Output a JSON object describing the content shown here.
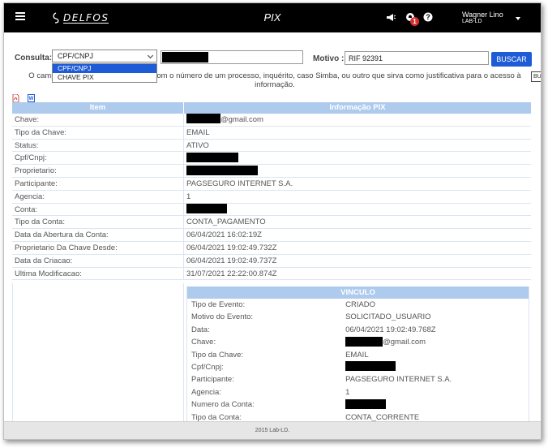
{
  "header": {
    "logo_text": "DELFOS",
    "title": "PIX",
    "user_name": "Wagner Lino",
    "user_org": "LAB-LD",
    "notification_count": "1",
    "menu_icon": "hamburger-icon",
    "announce_icon": "megaphone-icon",
    "help_icon": "question-icon"
  },
  "search": {
    "consulta_label": "Consulta:",
    "selected_option": "CPF/CNPJ",
    "options": [
      "CPF/CNPJ",
      "CHAVE PIX"
    ],
    "motivo_label": "Motivo :",
    "motivo_value": "RIF 92391",
    "button_label": "BUSCAR",
    "help_left": "O camp",
    "help_right": "com o número de um processo, inquérito, caso Simba, ou outro que sirva como justificativa para o acesso à",
    "help_line2": "informação.",
    "side_tab_label": "BU"
  },
  "colors": {
    "topbar": "#000000",
    "header_row": "#aecbee",
    "button": "#1e5bd6",
    "footer": "#e6e6e6"
  },
  "table": {
    "headers": [
      "Item",
      "Informação PIX"
    ],
    "rows": [
      {
        "label": "Chave:",
        "value": "@gmail.com",
        "redact_width": 42
      },
      {
        "label": "Tipo da Chave:",
        "value": "EMAIL"
      },
      {
        "label": "Status:",
        "value": "ATIVO"
      },
      {
        "label": "Cpf/Cnpj:",
        "value": "",
        "redact_width": 64
      },
      {
        "label": "Proprietario:",
        "value": "",
        "redact_width": 88
      },
      {
        "label": "Participante:",
        "value": "PAGSEGURO INTERNET S.A."
      },
      {
        "label": "Agencia:",
        "value": "1"
      },
      {
        "label": "Conta:",
        "value": "",
        "redact_width": 50
      },
      {
        "label": "Tipo da Conta:",
        "value": "CONTA_PAGAMENTO"
      },
      {
        "label": "Data da Abertura da Conta:",
        "value": "06/04/2021 16:02:19Z"
      },
      {
        "label": "Proprietario Da Chave Desde:",
        "value": "06/04/2021 19:02:49.732Z"
      },
      {
        "label": "Data da Criacao:",
        "value": "06/04/2021 19:02:49.737Z"
      },
      {
        "label": "Ultima Modificacao:",
        "value": "31/07/2021 22:22:00.874Z"
      }
    ]
  },
  "vinculo": {
    "title": "VINCULO",
    "rows": [
      {
        "label": "Tipo de Evento:",
        "value": "CRIADO"
      },
      {
        "label": "Motivo do Evento:",
        "value": "SOLICITADO_USUARIO"
      },
      {
        "label": "Data:",
        "value": "06/04/2021 19:02:49.768Z"
      },
      {
        "label": "Chave:",
        "value": "@gmail.com",
        "redact_width": 46
      },
      {
        "label": "Tipo da Chave:",
        "value": "EMAIL"
      },
      {
        "label": "Cpf/Cnpj:",
        "value": "",
        "redact_width": 62
      },
      {
        "label": "Participante:",
        "value": "PAGSEGURO INTERNET S.A."
      },
      {
        "label": "Agencia:",
        "value": "1"
      },
      {
        "label": "Numero da Conta:",
        "value": "",
        "redact_width": 50
      },
      {
        "label": "Tipo da Conta:",
        "value": "CONTA_CORRENTE"
      }
    ]
  },
  "footer": {
    "text": "2015 Lab-LD."
  }
}
